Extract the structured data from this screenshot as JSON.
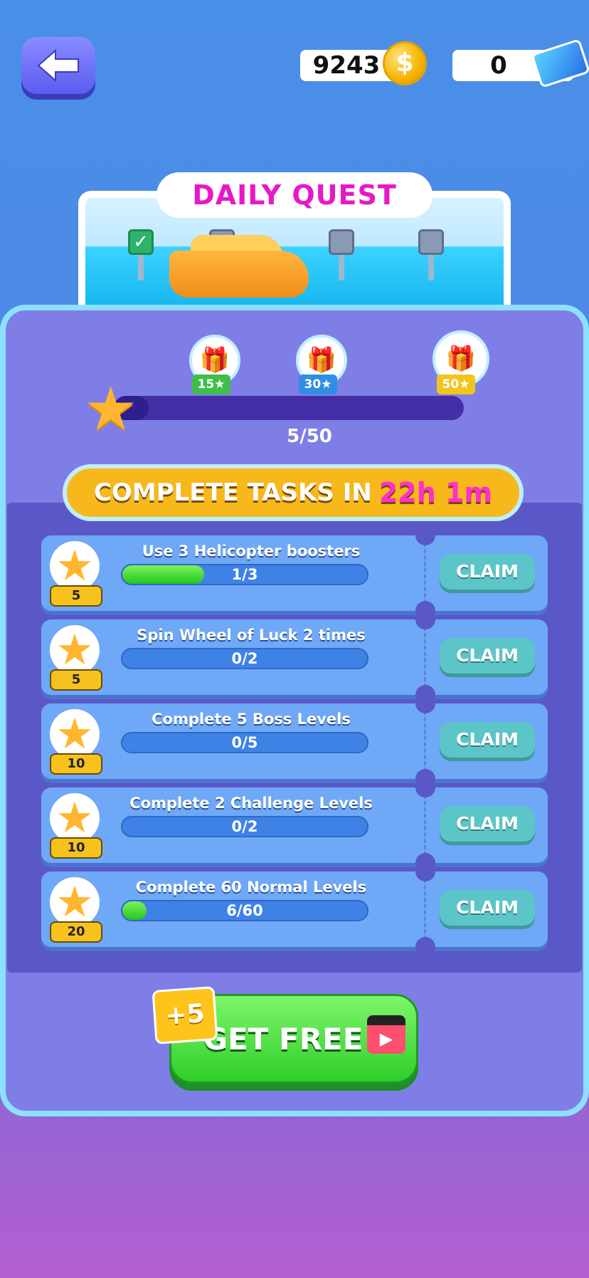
{
  "header": {
    "back_icon": "back-arrow-icon",
    "coins": "9243",
    "coin_icon": "coin-icon",
    "tickets": "0",
    "ticket_icon": "ticket-icon"
  },
  "title": "DAILY QUEST",
  "milestones": [
    {
      "value": "15",
      "color": "#3fbf4a"
    },
    {
      "value": "30",
      "color": "#2f8fe6"
    },
    {
      "value": "50",
      "color": "#f2c51c"
    }
  ],
  "progress": {
    "current": 5,
    "max": 50,
    "text": "5/50"
  },
  "timer": {
    "label": "COMPLETE TASKS IN",
    "value": "22h 1m"
  },
  "tasks": [
    {
      "name": "Use 3 Helicopter boosters",
      "points": "5",
      "progress_text": "1/3",
      "fraction": 0.333,
      "button": "CLAIM"
    },
    {
      "name": "Spin Wheel of Luck 2 times",
      "points": "5",
      "progress_text": "0/2",
      "fraction": 0,
      "button": "CLAIM"
    },
    {
      "name": "Complete 5 Boss Levels",
      "points": "10",
      "progress_text": "0/5",
      "fraction": 0,
      "button": "CLAIM"
    },
    {
      "name": "Complete 2 Challenge Levels",
      "points": "10",
      "progress_text": "0/2",
      "fraction": 0,
      "button": "CLAIM"
    },
    {
      "name": "Complete 60 Normal Levels",
      "points": "20",
      "progress_text": "6/60",
      "fraction": 0.1,
      "button": "CLAIM"
    }
  ],
  "free_button": {
    "bonus": "+5",
    "label": "GET FREE",
    "icon": "video-clapper-icon"
  },
  "colors": {
    "accent_pink": "#e818c6",
    "timer_pink": "#ff2fd1",
    "green": "#2fce2a",
    "panel": "#7e7ee6"
  }
}
